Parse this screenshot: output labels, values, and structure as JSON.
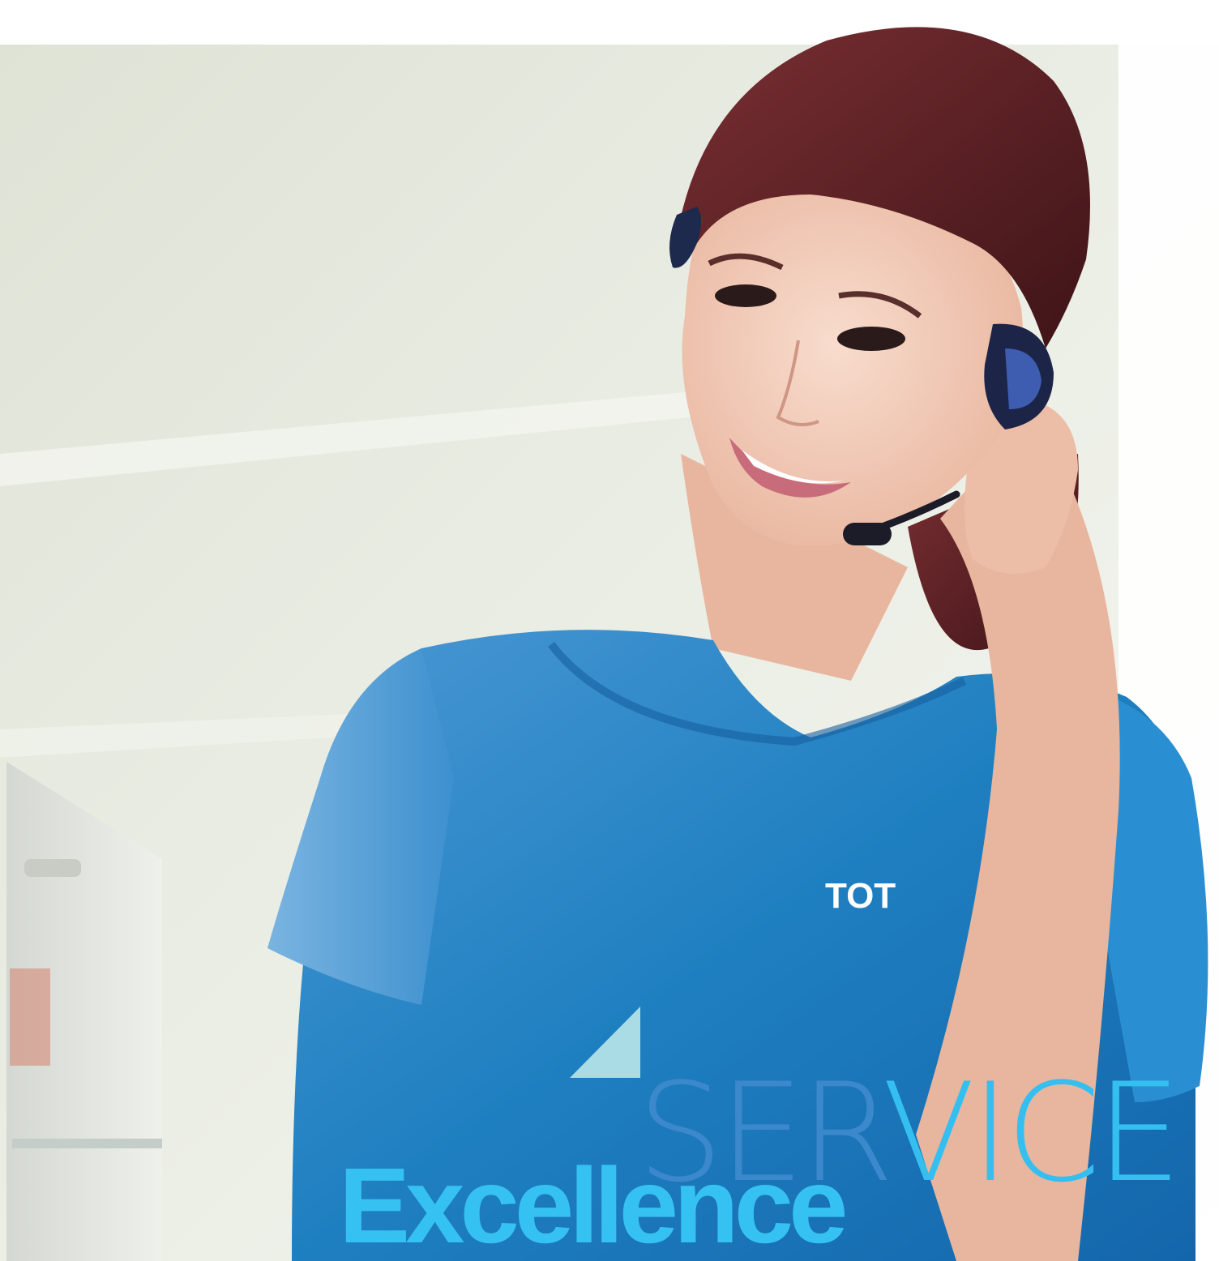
{
  "headline": {
    "service_part1": "SER",
    "service_part2": "VICE",
    "excellence": "Excellence"
  },
  "shirt_logo": "TOT",
  "colors": {
    "background": "#ffffff",
    "wall": "#e6e9df",
    "shirt": "#1e7fc0",
    "hair": "#5b1f23",
    "skin": "#f1c9b5",
    "accent_triangle": "#a9dce4",
    "service_text_dark": "#3b88cc",
    "service_text_light": "#35bff0",
    "excellence_text": "#35c2f2"
  },
  "image": {
    "description": "Smiling customer service agent wearing a headset and blue TOT uniform"
  }
}
